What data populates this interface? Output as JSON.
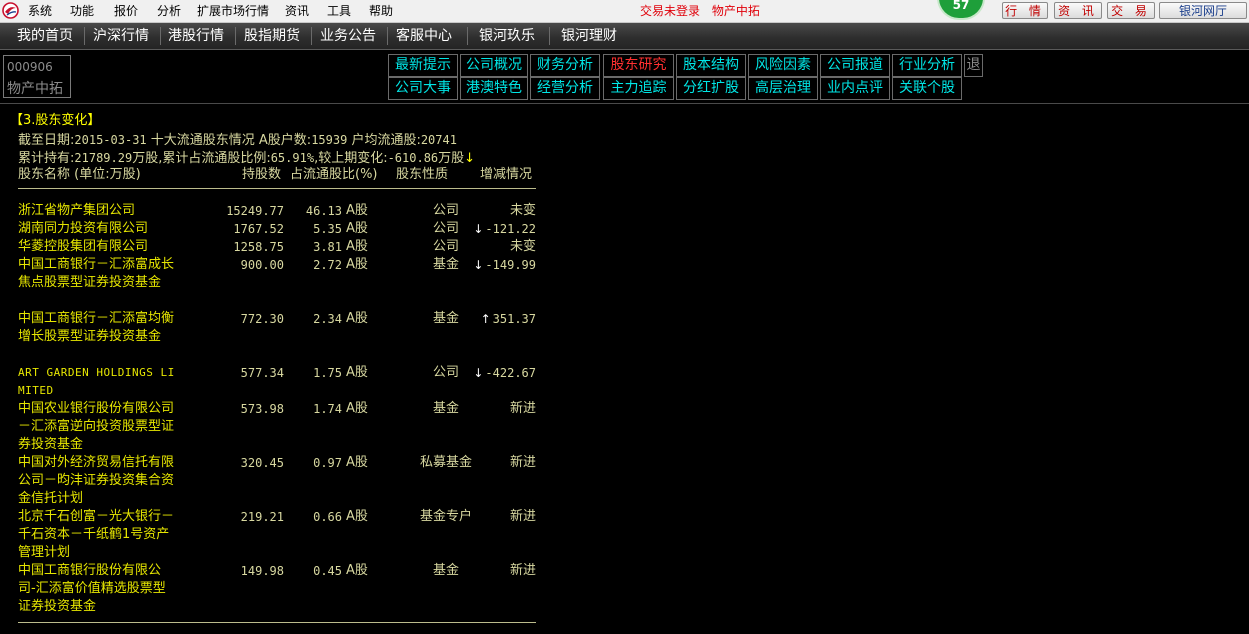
{
  "menubar": {
    "items": [
      "系统",
      "功能",
      "报价",
      "分析",
      "扩展市场行情",
      "资讯",
      "工具",
      "帮助"
    ],
    "status": [
      "交易未登录",
      "物产中拓"
    ],
    "notification_count": "57",
    "buttons": [
      "行 情",
      "资 讯",
      "交 易",
      "银河网厅"
    ],
    "accent_red": "#e0000a"
  },
  "nav": {
    "items": [
      "我的首页",
      "沪深行情",
      "港股行情",
      "股指期货",
      "业务公告",
      "客服中心",
      "银河玖乐",
      "银河理财"
    ]
  },
  "stock": {
    "code": "000906",
    "name": "物产中拓"
  },
  "f10_tabs": {
    "row1": [
      "最新提示",
      "公司概况",
      "财务分析",
      "股东研究",
      "股本结构",
      "风险因素",
      "公司报道",
      "行业分析"
    ],
    "row2": [
      "公司大事",
      "港澳特色",
      "经营分析",
      "主力追踪",
      "分红扩股",
      "高层治理",
      "业内点评",
      "关联个股"
    ],
    "active": "股东研究",
    "exit": "退",
    "tab_color": "#00e5e5",
    "active_color": "#ff3030"
  },
  "report": {
    "section_title": "【3.股东变化】",
    "line1": {
      "label1": "截至日期:",
      "date": "2015-03-31",
      "label2": " 十大流通股东情况 A股户数:",
      "holders": "15939",
      "label3": " 户均流通股:",
      "avg": "20741"
    },
    "line2": {
      "label1": "累计持有:",
      "total": "21789.29",
      "label2": "万股,累计占流通股比例:",
      "ratio": "65.91%",
      "label3": ",较上期变化:",
      "change": "-610.86",
      "label4": "万股",
      "arrow": "↓"
    },
    "columns": [
      "股东名称 (单位:万股)",
      "持股数",
      "占流通股比(%)",
      "股东性质",
      "增减情况"
    ],
    "rows": [
      {
        "name": "浙江省物产集团公司",
        "shares": "15249.77",
        "ratio": "46.13",
        "share_type": "A股",
        "nature": "公司",
        "dir": "",
        "change": "未变"
      },
      {
        "name": "湖南同力投资有限公司",
        "shares": "1767.52",
        "ratio": "5.35",
        "share_type": "A股",
        "nature": "公司",
        "dir": "↓",
        "change": "-121.22"
      },
      {
        "name": "华菱控股集团有限公司",
        "shares": "1258.75",
        "ratio": "3.81",
        "share_type": "A股",
        "nature": "公司",
        "dir": "",
        "change": "未变"
      },
      {
        "name": "中国工商银行－汇添富成长焦点股票型证券投资基金",
        "shares": "900.00",
        "ratio": "2.72",
        "share_type": "A股",
        "nature": "基金",
        "dir": "↓",
        "change": "-149.99"
      },
      {
        "name": "中国工商银行－汇添富均衡增长股票型证券投资基金",
        "shares": "772.30",
        "ratio": "2.34",
        "share_type": "A股",
        "nature": "基金",
        "dir": "↑",
        "change": "351.37"
      },
      {
        "name": "ART GARDEN HOLDINGS LIMITED",
        "shares": "577.34",
        "ratio": "1.75",
        "share_type": "A股",
        "nature": "公司",
        "dir": "↓",
        "change": "-422.67"
      },
      {
        "name": "中国农业银行股份有限公司－汇添富逆向投资股票型证券投资基金",
        "shares": "573.98",
        "ratio": "1.74",
        "share_type": "A股",
        "nature": "基金",
        "dir": "",
        "change": "新进"
      },
      {
        "name": "中国对外经济贸易信托有限公司－昀沣证券投资集合资金信托计划",
        "shares": "320.45",
        "ratio": "0.97",
        "share_type": "A股",
        "nature": "私募基金",
        "dir": "",
        "change": "新进"
      },
      {
        "name": "北京千石创富－光大银行－千石资本－千纸鹤1号资产管理计划",
        "shares": "219.21",
        "ratio": "0.66",
        "share_type": "A股",
        "nature": "基金专户",
        "dir": "",
        "change": "新进"
      },
      {
        "name": "中国工商银行股份有限公司-汇添富价值精选股票型证券投资基金",
        "shares": "149.98",
        "ratio": "0.45",
        "share_type": "A股",
        "nature": "基金",
        "dir": "",
        "change": "新进"
      }
    ],
    "text_color": "#d8d8a0",
    "name_color": "#e6e600"
  }
}
